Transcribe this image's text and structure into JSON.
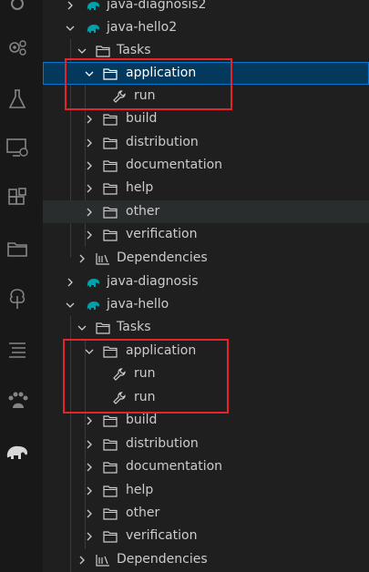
{
  "activity_bar": {
    "icons": [
      "settings-gear-icon",
      "beaker-test-icon",
      "remote-explorer-icon",
      "extensions-icon",
      "folder-icon",
      "tree-icon",
      "outline-icon",
      "paw-icon",
      "gradle-elephant-icon"
    ]
  },
  "tree": {
    "projects": [
      {
        "name": "java-diagnosis2"
      },
      {
        "name": "java-hello2"
      },
      {
        "name": "java-diagnosis"
      },
      {
        "name": "java-hello"
      }
    ],
    "tasks_label": "Tasks",
    "dependencies_label": "Dependencies",
    "groups": {
      "application": "application",
      "build": "build",
      "distribution": "distribution",
      "documentation": "documentation",
      "help": "help",
      "other": "other",
      "verification": "verification"
    },
    "run_label": "run"
  },
  "colors": {
    "background": "#1f1f1f",
    "selection": "#04395e",
    "focus_border": "#0078d4",
    "annotation": "#e5242a",
    "gradle_icon": "#02a0a8"
  }
}
